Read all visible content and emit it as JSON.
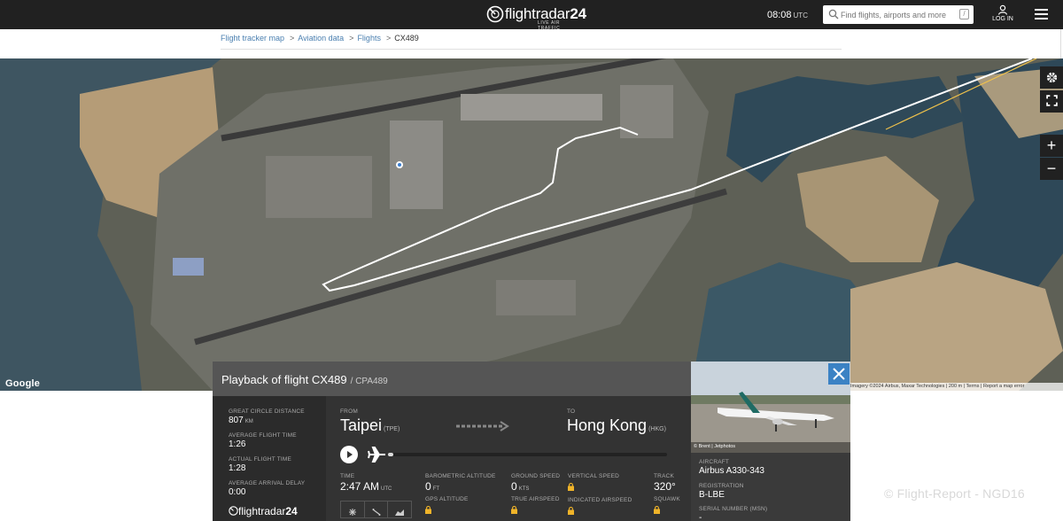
{
  "topbar": {
    "logo_main": "flightradar",
    "logo_num": "24",
    "logo_sub": "LIVE AIR TRAFFIC",
    "time": "08:08",
    "time_zone": "UTC",
    "search_placeholder": "Find flights, airports and more",
    "search_shortcut": "/",
    "login_label": "LOG IN"
  },
  "breadcrumb": {
    "items": [
      "Flight tracker map",
      "Aviation data",
      "Flights"
    ],
    "current": "CX489",
    "separator": ">"
  },
  "map": {
    "google_label": "Google",
    "attribution": "Imagery ©2024 Airbus, Maxar Technologies | 200 m |  Terms  | Report a map error",
    "controls": [
      "gear-icon",
      "fullscreen-icon",
      "zoom-in",
      "zoom-out"
    ],
    "zoom_in_label": "+",
    "zoom_out_label": "−",
    "track_color": "#ffffff",
    "great_circle_color": "#f0c24b"
  },
  "panel": {
    "title": "Playback of flight CX489",
    "callsign": "/ CPA489",
    "great_circle_label": "GREAT CIRCLE DISTANCE",
    "great_circle_value": "807",
    "great_circle_unit": "KM",
    "avg_flight_label": "AVERAGE FLIGHT TIME",
    "avg_flight_value": "1:26",
    "actual_flight_label": "ACTUAL FLIGHT TIME",
    "actual_flight_value": "1:28",
    "avg_delay_label": "AVERAGE ARRIVAL DELAY",
    "avg_delay_value": "0:00",
    "fr24_main": "flightradar",
    "fr24_num": "24",
    "from_label": "FROM",
    "from_city": "Taipei",
    "from_code": "(TPE)",
    "to_label": "TO",
    "to_city": "Hong Kong",
    "to_code": "(HKG)",
    "progress": 0.02,
    "time_label": "TIME",
    "time_value": "2:47 AM",
    "time_unit": "UTC",
    "baro_label": "BAROMETRIC ALTITUDE",
    "baro_value": "0",
    "baro_unit": "FT",
    "gps_label": "GPS ALTITUDE",
    "ground_speed_label": "GROUND SPEED",
    "ground_speed_value": "0",
    "ground_speed_unit": "KTS",
    "true_airspeed_label": "TRUE AIRSPEED",
    "vertical_speed_label": "VERTICAL SPEED",
    "indicated_airspeed_label": "INDICATED AIRSPEED",
    "track_label": "TRACK",
    "track_value": "320°",
    "squawk_label": "SQUAWK"
  },
  "aircraft": {
    "photo_credit": "© Brent | Jetphotos",
    "aircraft_label": "AIRCRAFT",
    "aircraft_value": "Airbus A330-343",
    "registration_label": "REGISTRATION",
    "registration_value": "B-LBE",
    "serial_label": "SERIAL NUMBER (MSN)",
    "serial_value": "-"
  },
  "watermark": "© Flight-Report - NGD16"
}
